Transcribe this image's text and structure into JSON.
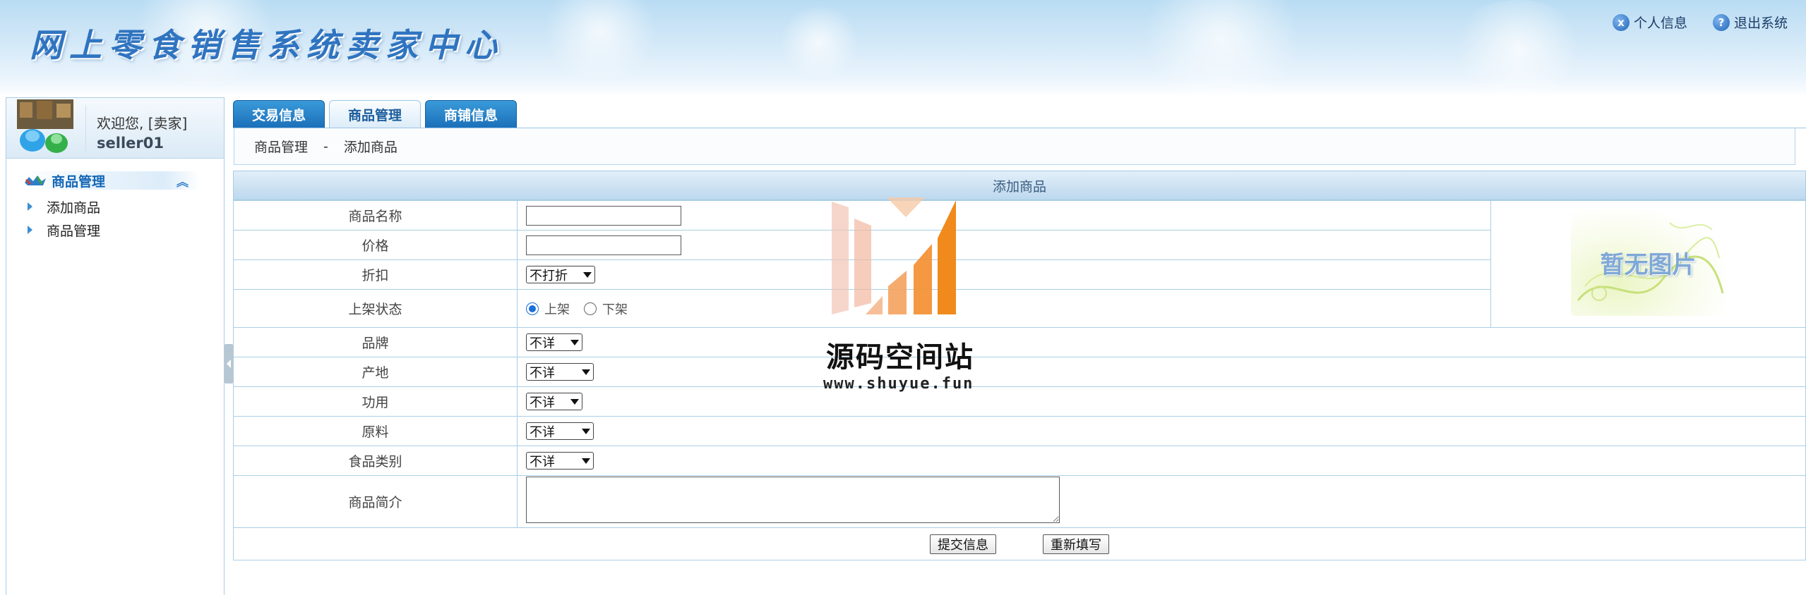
{
  "header": {
    "site_title": "网上零食销售系统卖家中心",
    "profile_link": "个人信息",
    "logout_link": "退出系统",
    "profile_icon_glyph": "x",
    "logout_icon_glyph": "?"
  },
  "user": {
    "welcome": "欢迎您, [卖家]",
    "username": "seller01"
  },
  "sidebar": {
    "menu_title": "商品管理",
    "collapse_glyph": "︽",
    "items": [
      {
        "label": "添加商品"
      },
      {
        "label": "商品管理"
      }
    ]
  },
  "tabs": [
    {
      "label": "交易信息",
      "active": false
    },
    {
      "label": "商品管理",
      "active": true
    },
    {
      "label": "商铺信息",
      "active": false
    }
  ],
  "breadcrumb": {
    "section": "商品管理",
    "separator": "-",
    "page": "添加商品"
  },
  "form": {
    "title": "添加商品",
    "fields": {
      "name": {
        "label": "商品名称",
        "value": ""
      },
      "price": {
        "label": "价格",
        "value": ""
      },
      "discount": {
        "label": "折扣",
        "selected": "不打折"
      },
      "status": {
        "label": "上架状态",
        "options": [
          "上架",
          "下架"
        ],
        "selected": "上架"
      },
      "brand": {
        "label": "品牌",
        "selected": "不详"
      },
      "origin": {
        "label": "产地",
        "selected": "不详"
      },
      "function": {
        "label": "功用",
        "selected": "不详"
      },
      "ingredient": {
        "label": "原料",
        "selected": "不详"
      },
      "category": {
        "label": "食品类别",
        "selected": "不详"
      },
      "description": {
        "label": "商品简介",
        "value": ""
      }
    },
    "image_placeholder": "暂无图片",
    "submit_label": "提交信息",
    "reset_label": "重新填写"
  },
  "watermark": {
    "title": "源码空间站",
    "url": "www.shuyue.fun"
  },
  "colors": {
    "tab_blue": "#1a6fb8",
    "border_blue": "#a9cfe6",
    "title_blue": "#2f74c0",
    "watermark_orange": "#f08a1c"
  }
}
